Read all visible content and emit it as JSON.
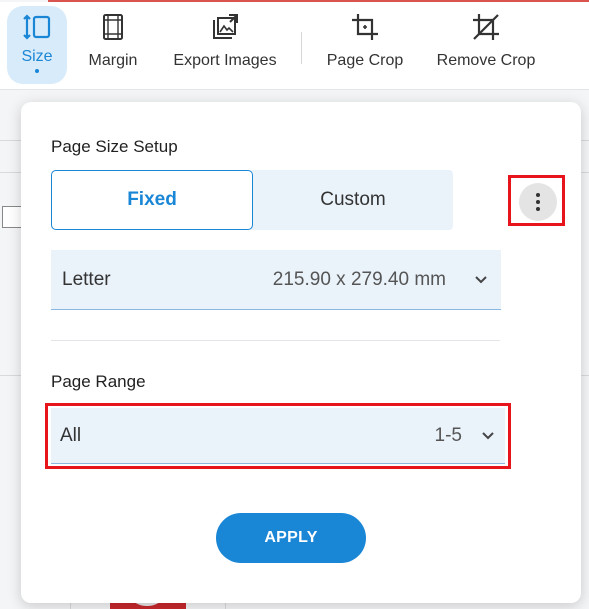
{
  "toolbar": {
    "items": [
      {
        "label": "Size",
        "icon": "page-size-icon",
        "active": true
      },
      {
        "label": "Margin",
        "icon": "margin-icon",
        "active": false
      },
      {
        "label": "Export Images",
        "icon": "export-images-icon",
        "active": false
      },
      {
        "label": "Page Crop",
        "icon": "crop-icon",
        "active": false
      },
      {
        "label": "Remove Crop",
        "icon": "remove-crop-icon",
        "active": false
      }
    ]
  },
  "panel": {
    "size_title": "Page Size Setup",
    "tabs": [
      {
        "label": "Fixed",
        "selected": true
      },
      {
        "label": "Custom",
        "selected": false
      }
    ],
    "more_icon": "kebab-menu-icon",
    "paper_select": {
      "name": "Letter",
      "dimensions": "215.90 x 279.40 mm"
    },
    "range_title": "Page Range",
    "range_select": {
      "name": "All",
      "value": "1-5"
    },
    "apply_label": "APPLY"
  },
  "colors": {
    "accent": "#1a86d6",
    "highlight": "#e8141c",
    "field_bg": "#eaf2fa"
  }
}
